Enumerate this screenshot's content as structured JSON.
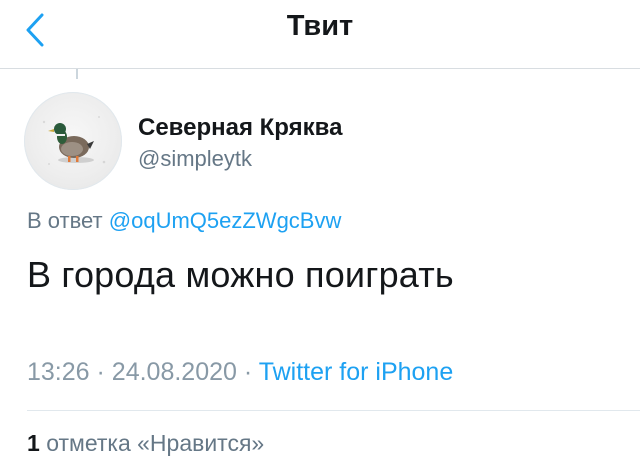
{
  "nav": {
    "title": "Твит",
    "back_icon": "chevron-left-icon",
    "accent_color": "#1da1f2"
  },
  "author": {
    "name": "Северная Кряква",
    "handle": "@simpleytk",
    "avatar": "mallard-duck-on-snow"
  },
  "reply": {
    "prefix": "В ответ",
    "mention": "@oqUmQ5ezZWgcBvw"
  },
  "tweet": {
    "text": "В города можно поиграть"
  },
  "meta": {
    "time": "13:26",
    "separator": "·",
    "date": "24.08.2020",
    "source": "Twitter for iPhone"
  },
  "likes": {
    "count": "1",
    "label": "отметка «Нравится»"
  }
}
